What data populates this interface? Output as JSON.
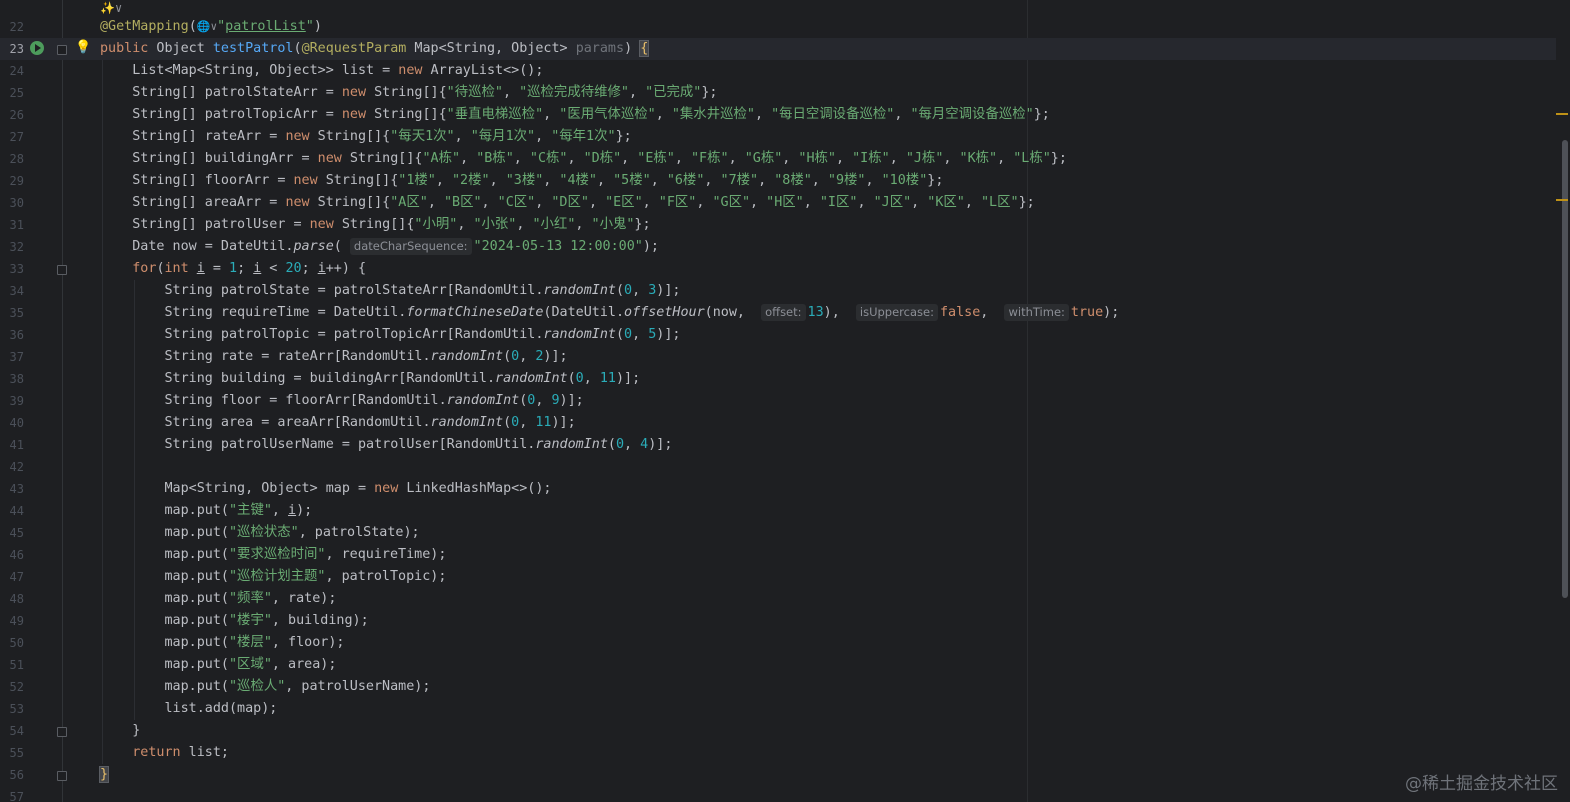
{
  "editor": {
    "top_hint": "✨∨",
    "watermark": "@稀土掘金技术社区",
    "lines": [
      {
        "n": "22",
        "html": "<span class=\"ann\">@GetMapping</span>(<span class=\"globe\">🌐∨</span><span class=\"str\">\"<span class=\"under\">patrolList</span>\"</span>)"
      },
      {
        "n": "23",
        "current": true,
        "html": "<span class=\"kw\">public</span> Object <span class=\"fn\">testPatrol</span>(<span class=\"ann\">@RequestParam</span> Map&lt;String, Object&gt; <span class=\"param-unused\">params</span>) <span class=\"brace-hl yellow-brace\">{</span>"
      },
      {
        "n": "24",
        "html": "    List&lt;Map&lt;String, Object&gt;&gt; list = <span class=\"kw\">new</span> ArrayList&lt;&gt;();"
      },
      {
        "n": "25",
        "html": "    String[] patrolStateArr = <span class=\"kw\">new</span> String[]{<span class=\"str\">\"待巡检\"</span>, <span class=\"str\">\"巡检完成待维修\"</span>, <span class=\"str\">\"已完成\"</span>};"
      },
      {
        "n": "26",
        "html": "    String[] patrolTopicArr = <span class=\"kw\">new</span> String[]{<span class=\"str\">\"垂直电梯巡检\"</span>, <span class=\"str\">\"医用气体巡检\"</span>, <span class=\"str\">\"集水井巡检\"</span>, <span class=\"str\">\"每日空调设备巡检\"</span>, <span class=\"str\">\"每月空调设备巡检\"</span>};"
      },
      {
        "n": "27",
        "html": "    String[] rateArr = <span class=\"kw\">new</span> String[]{<span class=\"str\">\"每天1次\"</span>, <span class=\"str\">\"每月1次\"</span>, <span class=\"str\">\"每年1次\"</span>};"
      },
      {
        "n": "28",
        "html": "    String[] buildingArr = <span class=\"kw\">new</span> String[]{<span class=\"str\">\"A栋\"</span>, <span class=\"str\">\"B栋\"</span>, <span class=\"str\">\"C栋\"</span>, <span class=\"str\">\"D栋\"</span>, <span class=\"str\">\"E栋\"</span>, <span class=\"str\">\"F栋\"</span>, <span class=\"str\">\"G栋\"</span>, <span class=\"str\">\"H栋\"</span>, <span class=\"str\">\"I栋\"</span>, <span class=\"str\">\"J栋\"</span>, <span class=\"str\">\"K栋\"</span>, <span class=\"str\">\"L栋\"</span>};"
      },
      {
        "n": "29",
        "html": "    String[] floorArr = <span class=\"kw\">new</span> String[]{<span class=\"str\">\"1楼\"</span>, <span class=\"str\">\"2楼\"</span>, <span class=\"str\">\"3楼\"</span>, <span class=\"str\">\"4楼\"</span>, <span class=\"str\">\"5楼\"</span>, <span class=\"str\">\"6楼\"</span>, <span class=\"str\">\"7楼\"</span>, <span class=\"str\">\"8楼\"</span>, <span class=\"str\">\"9楼\"</span>, <span class=\"str\">\"10楼\"</span>};"
      },
      {
        "n": "30",
        "html": "    String[] areaArr = <span class=\"kw\">new</span> String[]{<span class=\"str\">\"A区\"</span>, <span class=\"str\">\"B区\"</span>, <span class=\"str\">\"C区\"</span>, <span class=\"str\">\"D区\"</span>, <span class=\"str\">\"E区\"</span>, <span class=\"str\">\"F区\"</span>, <span class=\"str\">\"G区\"</span>, <span class=\"str\">\"H区\"</span>, <span class=\"str\">\"I区\"</span>, <span class=\"str\">\"J区\"</span>, <span class=\"str\">\"K区\"</span>, <span class=\"str\">\"L区\"</span>};"
      },
      {
        "n": "31",
        "html": "    String[] patrolUser = <span class=\"kw\">new</span> String[]{<span class=\"str\">\"小明\"</span>, <span class=\"str\">\"小张\"</span>, <span class=\"str\">\"小红\"</span>, <span class=\"str\">\"小鬼\"</span>};"
      },
      {
        "n": "32",
        "html": "    Date now = DateUtil.<span class=\"ital\">parse</span>( <span class=\"hint\">dateCharSequence:</span><span class=\"str\">\"2024-05-13 12:00:00\"</span>);"
      },
      {
        "n": "33",
        "fold": true,
        "html": "    <span class=\"kw\">for</span>(<span class=\"kw\">int</span> <span class=\"under\">i</span> = <span class=\"num\">1</span>; <span class=\"under\">i</span> &lt; <span class=\"num\">20</span>; <span class=\"under\">i</span>++) {"
      },
      {
        "n": "34",
        "html": "        String patrolState = patrolStateArr[RandomUtil.<span class=\"ital\">randomInt</span>(<span class=\"num\">0</span>, <span class=\"num\">3</span>)];"
      },
      {
        "n": "35",
        "html": "        String requireTime = DateUtil.<span class=\"ital\">formatChineseDate</span>(DateUtil.<span class=\"ital\">offsetHour</span>(now,  <span class=\"hint\">offset:</span><span class=\"num\">13</span>),  <span class=\"hint\">isUppercase:</span><span class=\"kw\">false</span>,  <span class=\"hint\">withTime:</span><span class=\"kw\">true</span>);"
      },
      {
        "n": "36",
        "html": "        String patrolTopic = patrolTopicArr[RandomUtil.<span class=\"ital\">randomInt</span>(<span class=\"num\">0</span>, <span class=\"num\">5</span>)];"
      },
      {
        "n": "37",
        "html": "        String rate = rateArr[RandomUtil.<span class=\"ital\">randomInt</span>(<span class=\"num\">0</span>, <span class=\"num\">2</span>)];"
      },
      {
        "n": "38",
        "html": "        String building = buildingArr[RandomUtil.<span class=\"ital\">randomInt</span>(<span class=\"num\">0</span>, <span class=\"num\">11</span>)];"
      },
      {
        "n": "39",
        "html": "        String floor = floorArr[RandomUtil.<span class=\"ital\">randomInt</span>(<span class=\"num\">0</span>, <span class=\"num\">9</span>)];"
      },
      {
        "n": "40",
        "html": "        String area = areaArr[RandomUtil.<span class=\"ital\">randomInt</span>(<span class=\"num\">0</span>, <span class=\"num\">11</span>)];"
      },
      {
        "n": "41",
        "html": "        String patrolUserName = patrolUser[RandomUtil.<span class=\"ital\">randomInt</span>(<span class=\"num\">0</span>, <span class=\"num\">4</span>)];"
      },
      {
        "n": "42",
        "html": ""
      },
      {
        "n": "43",
        "html": "        Map&lt;String, Object&gt; map = <span class=\"kw\">new</span> LinkedHashMap&lt;&gt;();"
      },
      {
        "n": "44",
        "html": "        map.put(<span class=\"str\">\"主键\"</span>, <span class=\"under\">i</span>);"
      },
      {
        "n": "45",
        "html": "        map.put(<span class=\"str\">\"巡检状态\"</span>, patrolState);"
      },
      {
        "n": "46",
        "html": "        map.put(<span class=\"str\">\"要求巡检时间\"</span>, requireTime);"
      },
      {
        "n": "47",
        "html": "        map.put(<span class=\"str\">\"巡检计划主题\"</span>, patrolTopic);"
      },
      {
        "n": "48",
        "html": "        map.put(<span class=\"str\">\"频率\"</span>, rate);"
      },
      {
        "n": "49",
        "html": "        map.put(<span class=\"str\">\"楼宇\"</span>, building);"
      },
      {
        "n": "50",
        "html": "        map.put(<span class=\"str\">\"楼层\"</span>, floor);"
      },
      {
        "n": "51",
        "html": "        map.put(<span class=\"str\">\"区域\"</span>, area);"
      },
      {
        "n": "52",
        "html": "        map.put(<span class=\"str\">\"巡检人\"</span>, patrolUserName);"
      },
      {
        "n": "53",
        "html": "        list.add(map);"
      },
      {
        "n": "54",
        "fold": true,
        "html": "    }"
      },
      {
        "n": "55",
        "html": "    <span class=\"kw\">return</span> list;"
      },
      {
        "n": "56",
        "fold": true,
        "html": "<span class=\"brace-hl yellow-brace\">}</span>"
      },
      {
        "n": "57",
        "html": ""
      }
    ]
  }
}
